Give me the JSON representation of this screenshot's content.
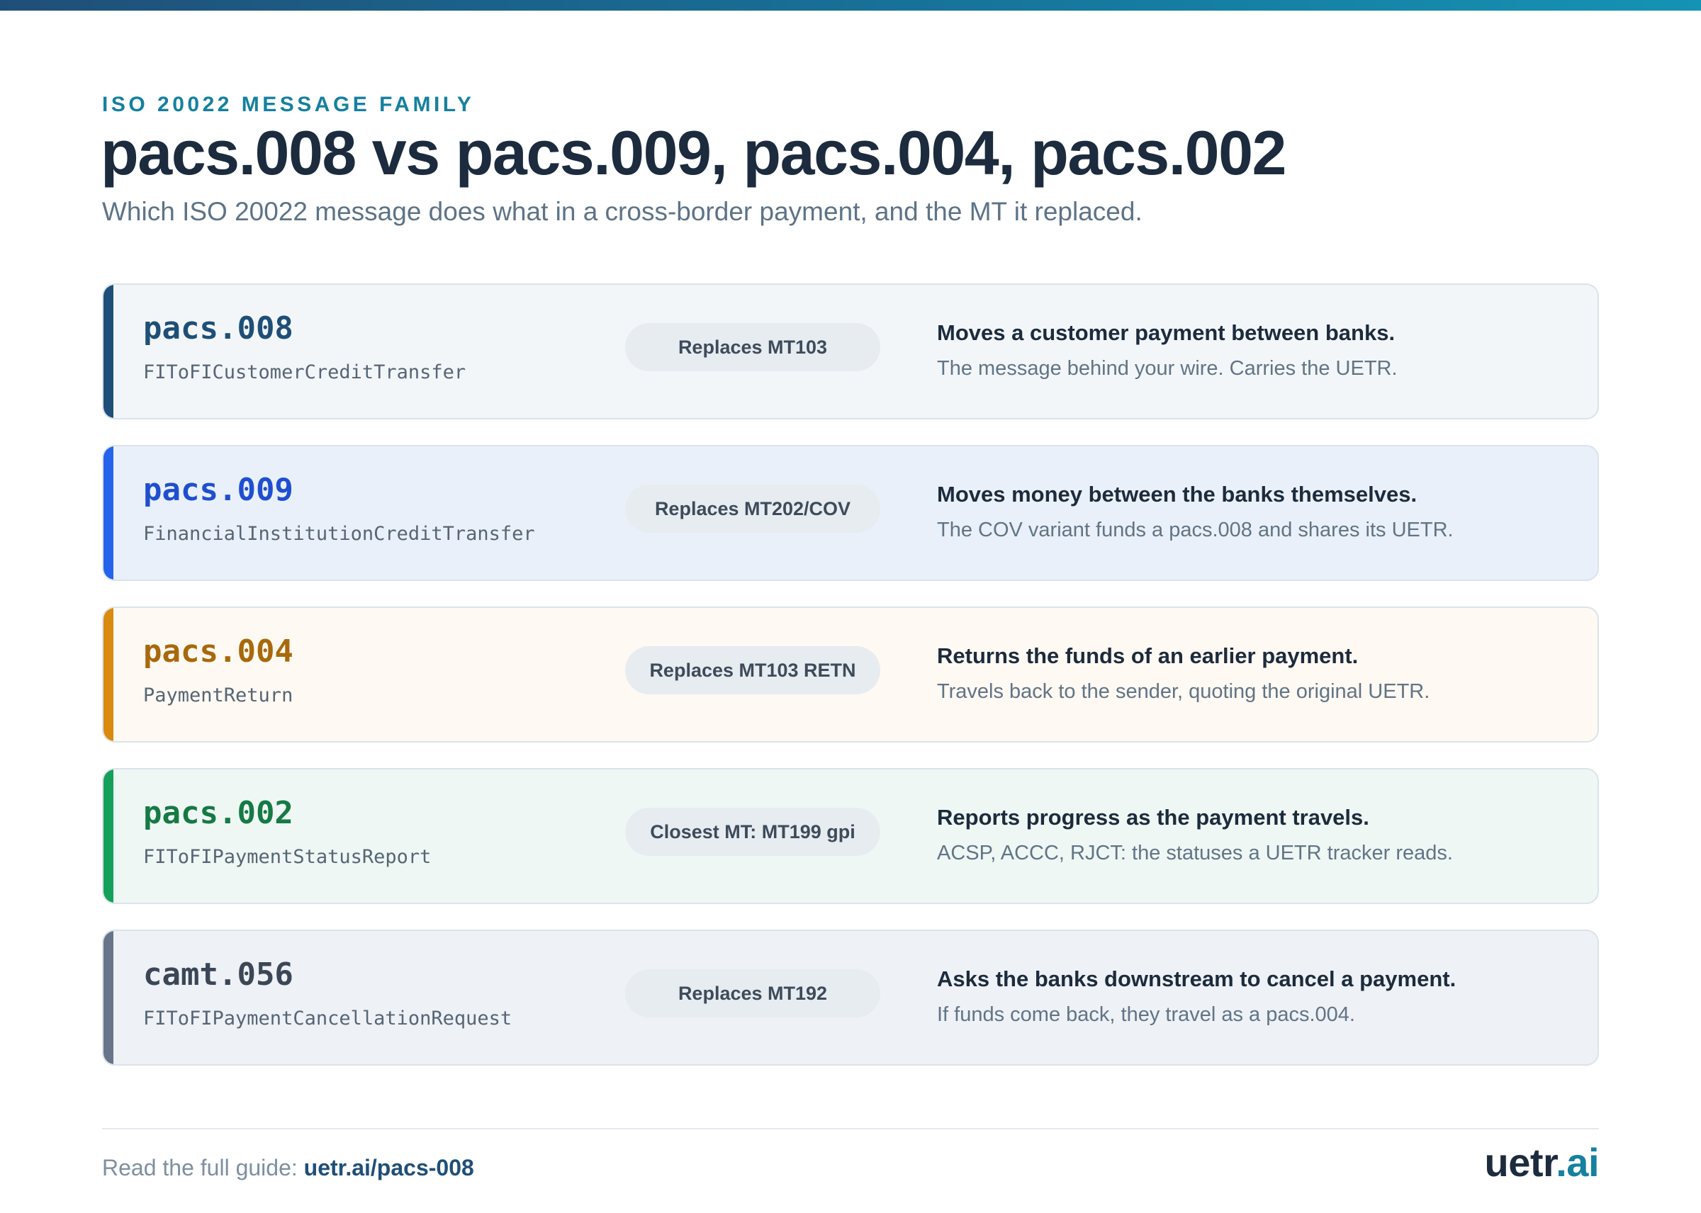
{
  "header": {
    "eyebrow": "ISO 20022 MESSAGE FAMILY",
    "title": "pacs.008 vs pacs.009, pacs.004, pacs.002",
    "subtitle": "Which ISO 20022 message does what in a cross-border payment, and the MT it replaced."
  },
  "messages": [
    {
      "code": "pacs.008",
      "long_name": "FIToFICustomerCreditTransfer",
      "replaces": "Replaces MT103",
      "headline": "Moves a customer payment between banks.",
      "description": "The message behind your wire. Carries the UETR.",
      "accent_color": "#1f4f78",
      "background_color": "#f3f6f9"
    },
    {
      "code": "pacs.009",
      "long_name": "FinancialInstitutionCreditTransfer",
      "replaces": "Replaces MT202/COV",
      "headline": "Moves money between the banks themselves.",
      "description": "The COV variant funds a pacs.008 and shares its UETR.",
      "accent_color": "#2563eb",
      "background_color": "#eaf0f9"
    },
    {
      "code": "pacs.004",
      "long_name": "PaymentReturn",
      "replaces": "Replaces MT103 RETN",
      "headline": "Returns the funds of an earlier payment.",
      "description": "Travels back to the sender, quoting the original UETR.",
      "accent_color": "#d98a0f",
      "background_color": "#fef9f2"
    },
    {
      "code": "pacs.002",
      "long_name": "FIToFIPaymentStatusReport",
      "replaces": "Closest MT: MT199 gpi",
      "headline": "Reports progress as the payment travels.",
      "description": "ACSP, ACCC, RJCT: the statuses a UETR tracker reads.",
      "accent_color": "#15a05a",
      "background_color": "#eff7f4"
    },
    {
      "code": "camt.056",
      "long_name": "FIToFIPaymentCancellationRequest",
      "replaces": "Replaces MT192",
      "headline": "Asks the banks downstream to cancel a payment.",
      "description": "If funds come back, they travel as a pacs.004.",
      "accent_color": "#66758a",
      "background_color": "#eef1f5"
    }
  ],
  "code_colors": [
    "#1f4f78",
    "#1f4fd0",
    "#a8690c",
    "#157a44",
    "#3b4656"
  ],
  "footer": {
    "prefix": "Read the full guide: ",
    "link": "uetr.ai/pacs-008",
    "brand_main": "uetr",
    "brand_suffix": ".ai"
  }
}
